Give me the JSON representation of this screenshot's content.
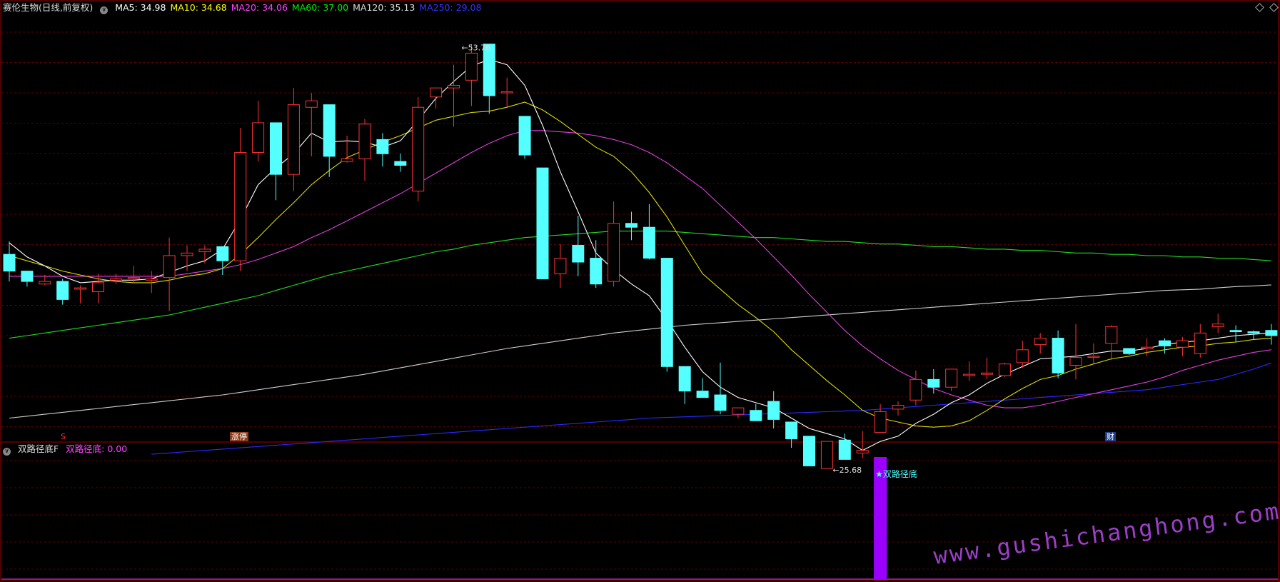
{
  "main_panel": {
    "title": "赛伦生物(日线,前复权)",
    "ma_labels": [
      {
        "text": "MA5: 34.98",
        "color": "#ffffff"
      },
      {
        "text": "MA10: 34.68",
        "color": "#ffff00"
      },
      {
        "text": "MA20: 34.06",
        "color": "#ff44ff"
      },
      {
        "text": "MA60: 37.00",
        "color": "#00ee00"
      },
      {
        "text": "MA120: 35.13",
        "color": "#dddddd"
      },
      {
        "text": "MA250: 29.08",
        "color": "#3333ff"
      }
    ],
    "high_marker": "53.76",
    "low_marker": "25.68",
    "events": [
      {
        "text": "S",
        "color": "#ff3333"
      },
      {
        "text": "涨停",
        "color": "#ffffff",
        "bg": "#8a3b1a"
      },
      {
        "text": "财",
        "color": "#ffffff",
        "bg": "#1a3a8a"
      }
    ]
  },
  "sub_panel": {
    "title": "双路径底F",
    "value_label": "双路径底: 0.00",
    "signal_label": "★双路径底"
  },
  "watermark": "www.gushichanghong.com",
  "colors": {
    "up": "#ff3232",
    "down": "#54ffff",
    "grid": "#5a0000",
    "border": "#a00000",
    "signal_bar": "#9b00ff"
  },
  "chart_data": {
    "type": "candlestick",
    "title": "赛伦生物(日线,前复权)",
    "ylim": [
      24,
      56
    ],
    "candles": [
      [
        37.5,
        38.5,
        36.2,
        35.4
      ],
      [
        36.2,
        36.2,
        35.4,
        35.0
      ],
      [
        35.2,
        35.9,
        35.4,
        35.1
      ],
      [
        35.4,
        35.6,
        34.0,
        33.6
      ],
      [
        34.8,
        35.1,
        34.9,
        33.7
      ],
      [
        34.6,
        36.0,
        35.3,
        33.7
      ],
      [
        35.5,
        36.0,
        35.6,
        35.2
      ],
      [
        35.6,
        36.6,
        35.7,
        35.3
      ],
      [
        35.5,
        36.2,
        35.6,
        34.5
      ],
      [
        35.7,
        38.8,
        37.4,
        33.1
      ],
      [
        37.4,
        38.2,
        37.6,
        36.2
      ],
      [
        37.7,
        38.2,
        37.9,
        36.8
      ],
      [
        38.1,
        38.1,
        37.0,
        35.9
      ],
      [
        37.0,
        47.3,
        45.4,
        36.2
      ],
      [
        45.4,
        49.4,
        47.7,
        44.7
      ],
      [
        47.7,
        47.7,
        43.7,
        41.7
      ],
      [
        43.7,
        50.4,
        49.1,
        42.4
      ],
      [
        48.9,
        50.0,
        49.4,
        45.1
      ],
      [
        49.1,
        49.1,
        45.1,
        43.5
      ],
      [
        44.7,
        46.7,
        44.9,
        44.6
      ],
      [
        44.9,
        48.0,
        47.6,
        43.2
      ],
      [
        46.4,
        46.9,
        45.3,
        44.3
      ],
      [
        44.7,
        45.3,
        44.4,
        43.9
      ],
      [
        42.4,
        49.7,
        48.9,
        41.6
      ],
      [
        49.7,
        49.7,
        50.4,
        48.8
      ],
      [
        50.4,
        52.2,
        50.6,
        47.4
      ],
      [
        51.0,
        53.8,
        53.1,
        49.0
      ],
      [
        53.8,
        53.8,
        49.8,
        48.4
      ],
      [
        50.1,
        51.2,
        50.1,
        48.9
      ],
      [
        48.2,
        48.2,
        45.2,
        44.9
      ],
      [
        44.2,
        44.2,
        35.6,
        35.6
      ],
      [
        36.0,
        38.3,
        37.2,
        34.9
      ],
      [
        38.2,
        40.5,
        36.9,
        35.8
      ],
      [
        37.2,
        38.6,
        35.2,
        34.9
      ],
      [
        35.4,
        41.6,
        39.9,
        35.0
      ],
      [
        39.9,
        40.8,
        39.6,
        38.6
      ],
      [
        39.6,
        41.4,
        37.2,
        37.1
      ],
      [
        37.2,
        37.2,
        28.8,
        28.4
      ],
      [
        28.8,
        28.8,
        26.9,
        25.9
      ],
      [
        26.9,
        27.9,
        26.4,
        26.5
      ],
      [
        26.6,
        29.1,
        25.4,
        25.1
      ],
      [
        25.1,
        25.5,
        25.6,
        24.8
      ],
      [
        25.4,
        25.9,
        24.6,
        24.6
      ],
      [
        26.1,
        26.9,
        24.7,
        24.0
      ],
      [
        24.5,
        24.5,
        23.2,
        22.5
      ],
      [
        23.4,
        23.4,
        21.1,
        22.0
      ],
      [
        20.9,
        22.9,
        23.0,
        20.9
      ],
      [
        23.1,
        23.6,
        21.6,
        21.7
      ],
      [
        22.1,
        23.8,
        22.3,
        21.7
      ],
      [
        23.7,
        25.9,
        25.3,
        23.7
      ],
      [
        25.5,
        26.1,
        25.8,
        25.0
      ],
      [
        26.2,
        28.5,
        27.8,
        25.8
      ],
      [
        27.8,
        28.6,
        27.2,
        26.7
      ],
      [
        27.2,
        27.6,
        28.6,
        26.9
      ],
      [
        28.1,
        29.2,
        28.2,
        27.7
      ],
      [
        28.2,
        29.5,
        28.3,
        27.8
      ],
      [
        28.1,
        29.1,
        29.0,
        28.0
      ],
      [
        29.1,
        30.8,
        30.1,
        28.7
      ],
      [
        30.5,
        31.4,
        31.0,
        29.8
      ],
      [
        31.0,
        31.6,
        28.3,
        27.9
      ],
      [
        28.9,
        32.1,
        29.5,
        27.8
      ],
      [
        29.6,
        30.6,
        29.6,
        29.0
      ],
      [
        30.6,
        32.0,
        31.9,
        29.3
      ],
      [
        30.2,
        30.2,
        29.8,
        29.7
      ],
      [
        30.2,
        31.0,
        30.3,
        29.6
      ],
      [
        30.8,
        31.0,
        30.4,
        29.8
      ],
      [
        30.3,
        31.1,
        30.8,
        29.6
      ],
      [
        29.8,
        32.1,
        31.4,
        29.5
      ],
      [
        31.9,
        32.9,
        32.1,
        31.4
      ],
      [
        31.6,
        32.0,
        31.5,
        30.7
      ],
      [
        31.5,
        31.6,
        31.4,
        30.9
      ],
      [
        31.6,
        32.1,
        31.2,
        30.5
      ]
    ],
    "ma5": [
      38.4,
      37.3,
      36.6,
      35.8,
      35.3,
      35.4,
      35.5,
      35.5,
      35.6,
      36.1,
      36.6,
      37.0,
      37.9,
      40.2,
      42.9,
      44.2,
      45.3,
      46.9,
      46.2,
      46.3,
      46.2,
      45.8,
      46.3,
      47.9,
      49.6,
      50.9,
      52.1,
      52.6,
      52.2,
      50.6,
      47.5,
      43.9,
      40.8,
      37.6,
      36.3,
      35.2,
      34.3,
      32.4,
      30.3,
      28.4,
      27.2,
      26.4,
      26.0,
      25.6,
      24.8,
      24.0,
      23.6,
      23.2,
      22.3,
      23.0,
      23.4,
      24.4,
      25.1,
      26.0,
      26.6,
      27.5,
      28.2,
      28.8,
      29.4,
      29.5,
      29.6,
      29.8,
      30.0,
      30.0,
      30.2,
      30.5,
      30.7,
      30.8,
      31.0,
      31.2,
      31.3,
      31.4
    ],
    "ma10": [
      37.4,
      37.0,
      36.6,
      36.2,
      35.9,
      35.6,
      35.4,
      35.3,
      35.3,
      35.5,
      35.8,
      36.0,
      36.4,
      37.5,
      38.8,
      40.2,
      41.5,
      42.9,
      44.0,
      45.0,
      45.6,
      46.2,
      46.7,
      47.3,
      47.9,
      48.2,
      48.5,
      48.6,
      48.9,
      49.3,
      48.7,
      47.8,
      46.8,
      45.8,
      45.1,
      43.9,
      42.3,
      40.4,
      38.2,
      36.0,
      34.8,
      33.6,
      32.6,
      31.5,
      30.1,
      28.9,
      27.7,
      26.6,
      25.4,
      24.8,
      24.5,
      24.2,
      24.1,
      24.2,
      24.6,
      25.4,
      26.3,
      27.1,
      27.8,
      28.1,
      28.6,
      29.0,
      29.4,
      29.6,
      29.9,
      30.1,
      30.3,
      30.4,
      30.6,
      30.7,
      30.9,
      31.0
    ],
    "ma20": [
      35.8,
      35.8,
      35.8,
      35.8,
      35.8,
      35.8,
      35.8,
      35.8,
      35.8,
      35.8,
      36.0,
      36.2,
      36.4,
      36.7,
      37.1,
      37.6,
      38.1,
      38.8,
      39.4,
      40.1,
      40.8,
      41.5,
      42.2,
      43.0,
      43.8,
      44.6,
      45.4,
      46.1,
      46.7,
      47.1,
      47.1,
      47.0,
      46.9,
      46.7,
      46.4,
      46.0,
      45.4,
      44.6,
      43.6,
      42.6,
      41.3,
      40.0,
      38.7,
      37.3,
      35.9,
      34.4,
      33.0,
      31.6,
      30.4,
      29.4,
      28.5,
      27.8,
      27.1,
      26.6,
      26.2,
      25.8,
      25.6,
      25.6,
      25.8,
      26.1,
      26.4,
      26.7,
      27.0,
      27.3,
      27.6,
      28.0,
      28.5,
      28.9,
      29.3,
      29.6,
      29.9,
      30.1
    ],
    "ma60": [
      31.0,
      31.2,
      31.4,
      31.6,
      31.8,
      32.0,
      32.2,
      32.4,
      32.6,
      32.8,
      33.1,
      33.4,
      33.7,
      34.0,
      34.3,
      34.7,
      35.1,
      35.5,
      35.9,
      36.2,
      36.5,
      36.8,
      37.1,
      37.4,
      37.7,
      37.9,
      38.2,
      38.4,
      38.6,
      38.8,
      38.9,
      39.0,
      39.1,
      39.2,
      39.3,
      39.3,
      39.3,
      39.3,
      39.2,
      39.1,
      39.0,
      38.9,
      38.8,
      38.8,
      38.7,
      38.6,
      38.5,
      38.5,
      38.4,
      38.3,
      38.3,
      38.2,
      38.1,
      38.1,
      38.0,
      37.9,
      37.9,
      37.8,
      37.8,
      37.7,
      37.6,
      37.6,
      37.5,
      37.5,
      37.4,
      37.4,
      37.3,
      37.3,
      37.2,
      37.2,
      37.1,
      37.0
    ],
    "ma120": [
      24.8,
      24.95,
      25.1,
      25.25,
      25.4,
      25.55,
      25.7,
      25.85,
      26.0,
      26.15,
      26.3,
      26.45,
      26.6,
      26.8,
      27.0,
      27.2,
      27.4,
      27.6,
      27.8,
      28.0,
      28.2,
      28.45,
      28.7,
      28.95,
      29.2,
      29.45,
      29.7,
      29.95,
      30.2,
      30.4,
      30.6,
      30.8,
      31.0,
      31.2,
      31.4,
      31.55,
      31.7,
      31.85,
      32.0,
      32.1,
      32.2,
      32.3,
      32.4,
      32.5,
      32.6,
      32.7,
      32.8,
      32.9,
      33.0,
      33.1,
      33.2,
      33.3,
      33.4,
      33.5,
      33.6,
      33.7,
      33.8,
      33.9,
      34.0,
      34.1,
      34.2,
      34.3,
      34.4,
      34.5,
      34.6,
      34.7,
      34.75,
      34.8,
      34.9,
      35.0,
      35.05,
      35.13
    ],
    "ma250": [
      null,
      null,
      null,
      null,
      null,
      null,
      null,
      null,
      22.0,
      22.1,
      22.2,
      22.3,
      22.4,
      22.5,
      22.6,
      22.7,
      22.8,
      22.9,
      23.0,
      23.1,
      23.2,
      23.3,
      23.4,
      23.5,
      23.6,
      23.7,
      23.8,
      23.9,
      24.0,
      24.1,
      24.2,
      24.3,
      24.4,
      24.5,
      24.6,
      24.7,
      24.8,
      24.85,
      24.9,
      24.95,
      25.0,
      25.05,
      25.1,
      25.15,
      25.2,
      25.25,
      25.3,
      25.35,
      25.4,
      25.5,
      25.6,
      25.7,
      25.8,
      25.9,
      26.0,
      26.1,
      26.2,
      26.3,
      26.4,
      26.5,
      26.6,
      26.7,
      26.8,
      26.9,
      27.0,
      27.2,
      27.4,
      27.6,
      27.8,
      28.2,
      28.6,
      29.08
    ],
    "signal": {
      "index": 49,
      "value": 1,
      "series": "双路径底"
    }
  }
}
